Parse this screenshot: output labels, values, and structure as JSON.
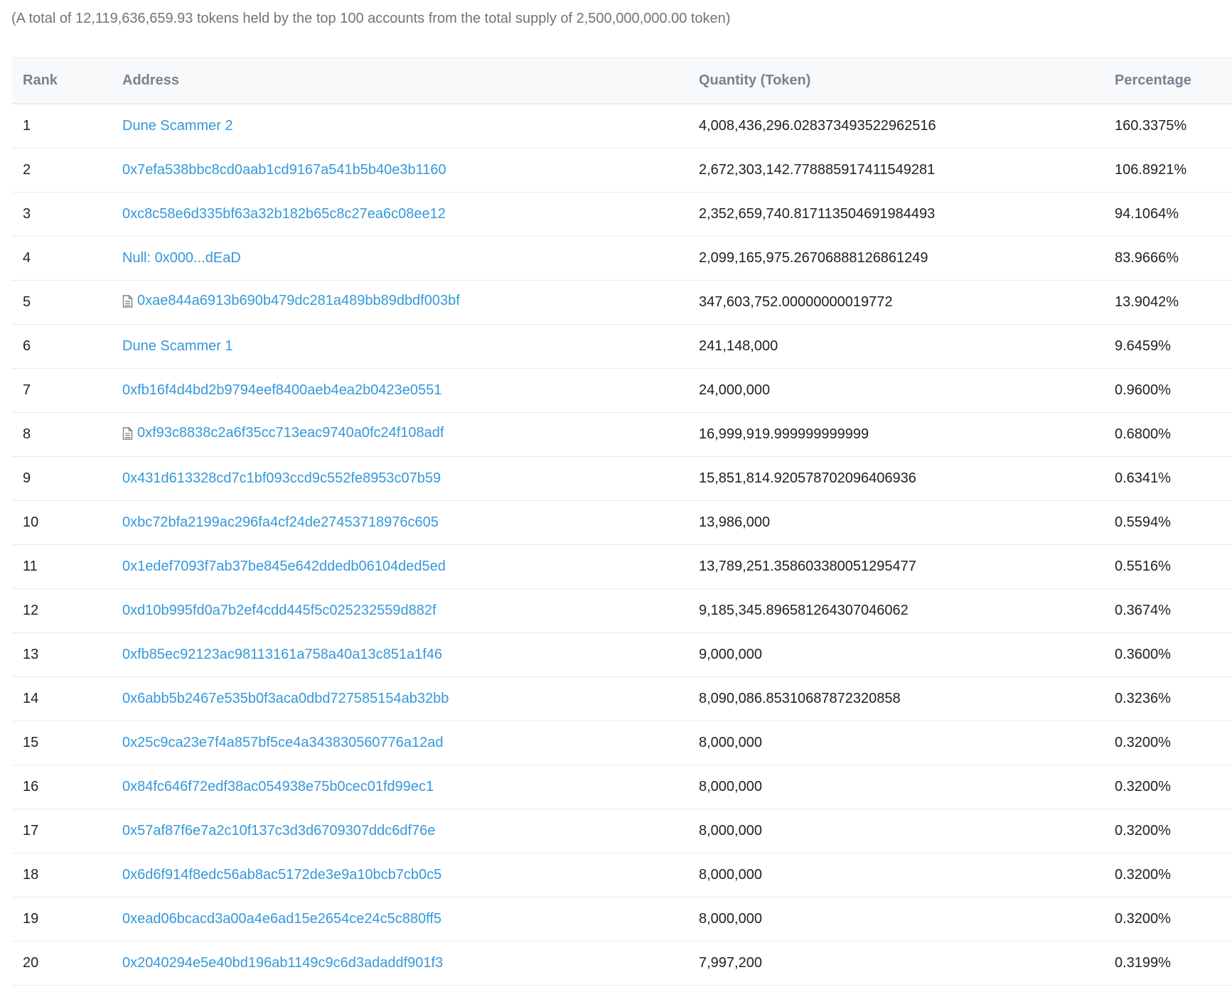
{
  "summary": "(A total of 12,119,636,659.93 tokens held by the top 100 accounts from the total supply of 2,500,000,000.00 token)",
  "table": {
    "headers": {
      "rank": "Rank",
      "address": "Address",
      "quantity": "Quantity (Token)",
      "percentage": "Percentage"
    },
    "rows": [
      {
        "rank": "1",
        "address": "Dune Scammer 2",
        "contract": false,
        "quantity": "4,008,436,296.028373493522962516",
        "percentage": "160.3375%"
      },
      {
        "rank": "2",
        "address": "0x7efa538bbc8cd0aab1cd9167a541b5b40e3b1160",
        "contract": false,
        "quantity": "2,672,303,142.778885917411549281",
        "percentage": "106.8921%"
      },
      {
        "rank": "3",
        "address": "0xc8c58e6d335bf63a32b182b65c8c27ea6c08ee12",
        "contract": false,
        "quantity": "2,352,659,740.817113504691984493",
        "percentage": "94.1064%"
      },
      {
        "rank": "4",
        "address": "Null: 0x000...dEaD",
        "contract": false,
        "quantity": "2,099,165,975.26706888126861249",
        "percentage": "83.9666%"
      },
      {
        "rank": "5",
        "address": "0xae844a6913b690b479dc281a489bb89dbdf003bf",
        "contract": true,
        "quantity": "347,603,752.00000000019772",
        "percentage": "13.9042%"
      },
      {
        "rank": "6",
        "address": "Dune Scammer 1",
        "contract": false,
        "quantity": "241,148,000",
        "percentage": "9.6459%"
      },
      {
        "rank": "7",
        "address": "0xfb16f4d4bd2b9794eef8400aeb4ea2b0423e0551",
        "contract": false,
        "quantity": "24,000,000",
        "percentage": "0.9600%"
      },
      {
        "rank": "8",
        "address": "0xf93c8838c2a6f35cc713eac9740a0fc24f108adf",
        "contract": true,
        "quantity": "16,999,919.999999999999",
        "percentage": "0.6800%"
      },
      {
        "rank": "9",
        "address": "0x431d613328cd7c1bf093ccd9c552fe8953c07b59",
        "contract": false,
        "quantity": "15,851,814.920578702096406936",
        "percentage": "0.6341%"
      },
      {
        "rank": "10",
        "address": "0xbc72bfa2199ac296fa4cf24de27453718976c605",
        "contract": false,
        "quantity": "13,986,000",
        "percentage": "0.5594%"
      },
      {
        "rank": "11",
        "address": "0x1edef7093f7ab37be845e642ddedb06104ded5ed",
        "contract": false,
        "quantity": "13,789,251.358603380051295477",
        "percentage": "0.5516%"
      },
      {
        "rank": "12",
        "address": "0xd10b995fd0a7b2ef4cdd445f5c025232559d882f",
        "contract": false,
        "quantity": "9,185,345.896581264307046062",
        "percentage": "0.3674%"
      },
      {
        "rank": "13",
        "address": "0xfb85ec92123ac98113161a758a40a13c851a1f46",
        "contract": false,
        "quantity": "9,000,000",
        "percentage": "0.3600%"
      },
      {
        "rank": "14",
        "address": "0x6abb5b2467e535b0f3aca0dbd727585154ab32bb",
        "contract": false,
        "quantity": "8,090,086.85310687872320858",
        "percentage": "0.3236%"
      },
      {
        "rank": "15",
        "address": "0x25c9ca23e7f4a857bf5ce4a343830560776a12ad",
        "contract": false,
        "quantity": "8,000,000",
        "percentage": "0.3200%"
      },
      {
        "rank": "16",
        "address": "0x84fc646f72edf38ac054938e75b0cec01fd99ec1",
        "contract": false,
        "quantity": "8,000,000",
        "percentage": "0.3200%"
      },
      {
        "rank": "17",
        "address": "0x57af87f6e7a2c10f137c3d3d6709307ddc6df76e",
        "contract": false,
        "quantity": "8,000,000",
        "percentage": "0.3200%"
      },
      {
        "rank": "18",
        "address": "0x6d6f914f8edc56ab8ac5172de3e9a10bcb7cb0c5",
        "contract": false,
        "quantity": "8,000,000",
        "percentage": "0.3200%"
      },
      {
        "rank": "19",
        "address": "0xead06bcacd3a00a4e6ad15e2654ce24c5c880ff5",
        "contract": false,
        "quantity": "8,000,000",
        "percentage": "0.3200%"
      },
      {
        "rank": "20",
        "address": "0x2040294e5e40bd196ab1149c9c6d3adaddf901f3",
        "contract": false,
        "quantity": "7,997,200",
        "percentage": "0.3199%"
      }
    ]
  },
  "colors": {
    "link": "#3498db",
    "header_text": "#77838f",
    "summary_text": "#6c757d",
    "border": "#e7eaf3"
  },
  "icons": {
    "contract": "contract-file-icon"
  }
}
